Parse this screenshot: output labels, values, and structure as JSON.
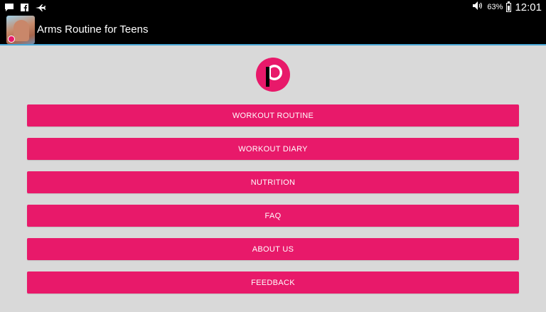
{
  "status_bar": {
    "icons": [
      "message-icon",
      "facebook-icon",
      "airplane-icon"
    ],
    "volume_icon": "volume-icon",
    "battery_percent": "63%",
    "battery_level": 0.63,
    "time": "12:01"
  },
  "action_bar": {
    "title": "Arms Routine for Teens",
    "app_icon": "app-icon-muscle"
  },
  "logo": {
    "icon": "logo-p-icon",
    "color": "#e8196a"
  },
  "menu": {
    "button_color": "#e8196a",
    "items": [
      {
        "label": "WORKOUT ROUTINE"
      },
      {
        "label": "WORKOUT DIARY"
      },
      {
        "label": "NUTRITION"
      },
      {
        "label": "FAQ"
      },
      {
        "label": "ABOUT US"
      },
      {
        "label": "FEEDBACK"
      }
    ]
  }
}
